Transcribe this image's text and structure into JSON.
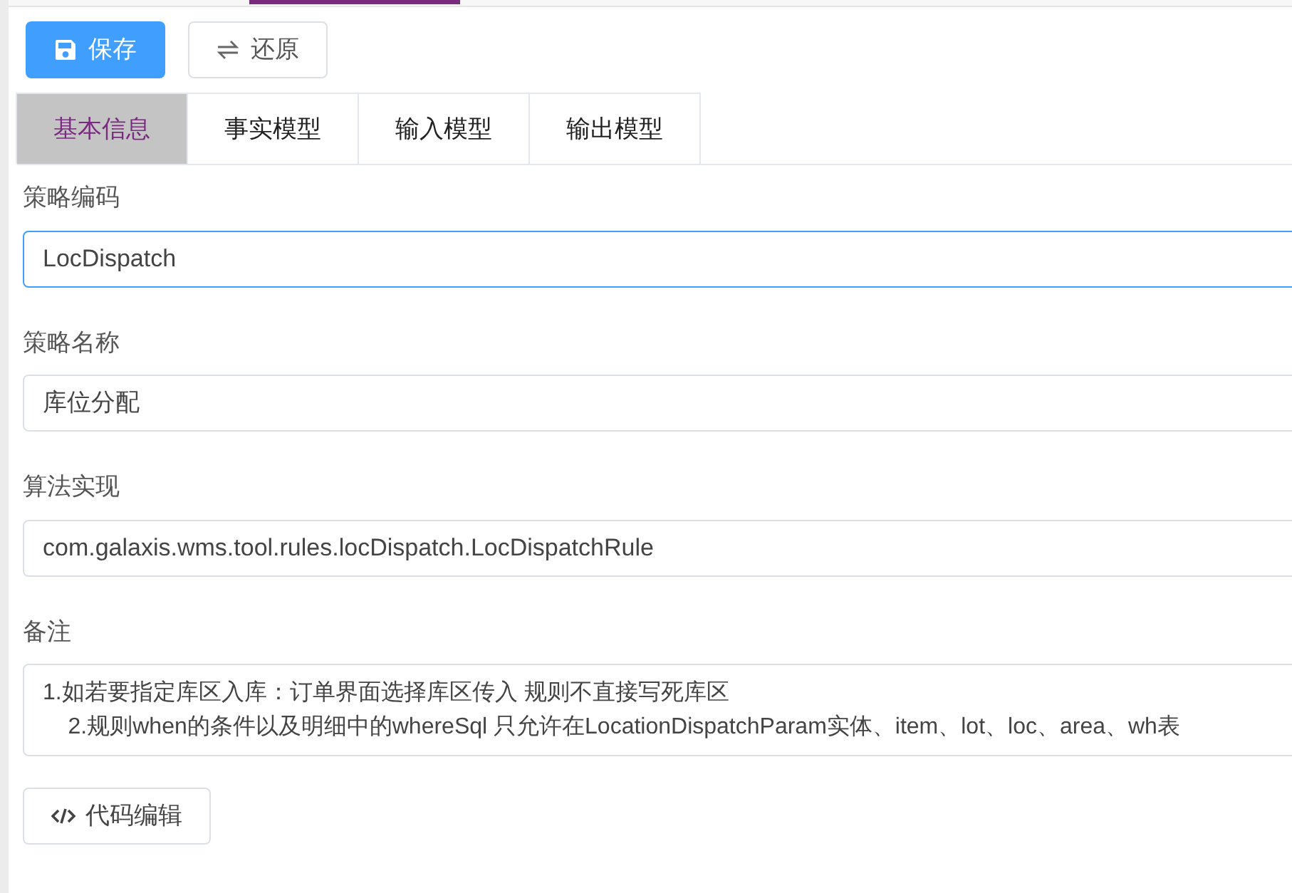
{
  "toolbar": {
    "buttons": [
      {
        "kind": "primary",
        "label": "保存"
      },
      {
        "kind": "secondary",
        "label": "还原"
      }
    ]
  },
  "tabs": [
    {
      "label": "基本信息",
      "selected": true
    },
    {
      "label": "事实模型",
      "selected": false
    },
    {
      "label": "输入模型",
      "selected": false
    },
    {
      "label": "输出模型",
      "selected": false
    }
  ],
  "fields": [
    {
      "label": "策略编码",
      "value": "LocDispatch",
      "focused": true
    },
    {
      "label": "策略名称",
      "value": "库位分配",
      "focused": false
    },
    {
      "label": "算法实现",
      "value": "com.galaxis.wms.tool.rules.locDispatch.LocDispatchRule",
      "focused": false
    }
  ],
  "remarks": {
    "label": "备注",
    "lines": [
      "1.如若要指定库区入库：订单界面选择库区传入 规则不直接写死库区",
      "    2.规则when的条件以及明细中的whereSql 只允许在LocationDispatchParam实体、item、lot、loc、area、wh表"
    ]
  },
  "code_button": {
    "label": "代码编辑"
  }
}
